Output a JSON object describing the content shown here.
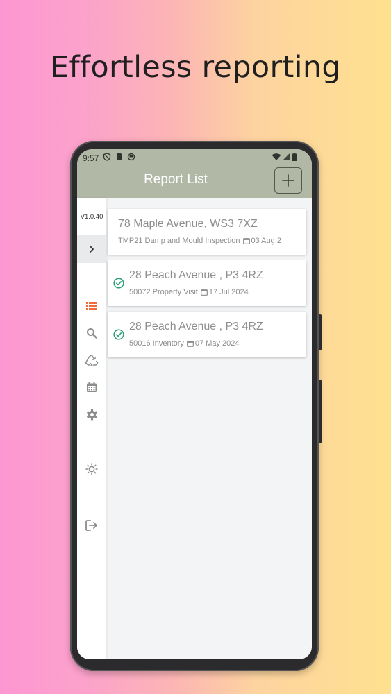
{
  "headline": "Effortless reporting",
  "status_bar": {
    "time": "9:57"
  },
  "header": {
    "title": "Report List",
    "add_button_icon": "plus-icon"
  },
  "sidebar": {
    "version": "V1.0.40",
    "expand_icon": "chevron-right-icon",
    "accent_color": "#f06a3a",
    "icon_color": "#8a8d8a",
    "items": [
      {
        "name": "list-icon",
        "active": true
      },
      {
        "name": "search-icon",
        "active": false
      },
      {
        "name": "recycle-icon",
        "active": false
      },
      {
        "name": "calendar-icon",
        "active": false
      },
      {
        "name": "gear-icon",
        "active": false
      },
      {
        "name": "brightness-icon",
        "active": false
      },
      {
        "name": "logout-icon",
        "active": false
      }
    ]
  },
  "reports": [
    {
      "address": "78 Maple Avenue, WS3 7XZ",
      "ref": "TMP21",
      "type": "Damp and Mould Inspection",
      "date": "03 Aug 2",
      "completed": false
    },
    {
      "address": "28 Peach Avenue  , P3 4RZ",
      "ref": "50072",
      "type": "Property Visit",
      "date": "17 Jul 2024",
      "completed": true
    },
    {
      "address": "28 Peach Avenue  , P3 4RZ",
      "ref": "50016",
      "type": "Inventory",
      "date": "07 May 2024",
      "completed": true
    }
  ],
  "colors": {
    "header_bg": "#b2b8a6",
    "check_color": "#2e9d77"
  }
}
